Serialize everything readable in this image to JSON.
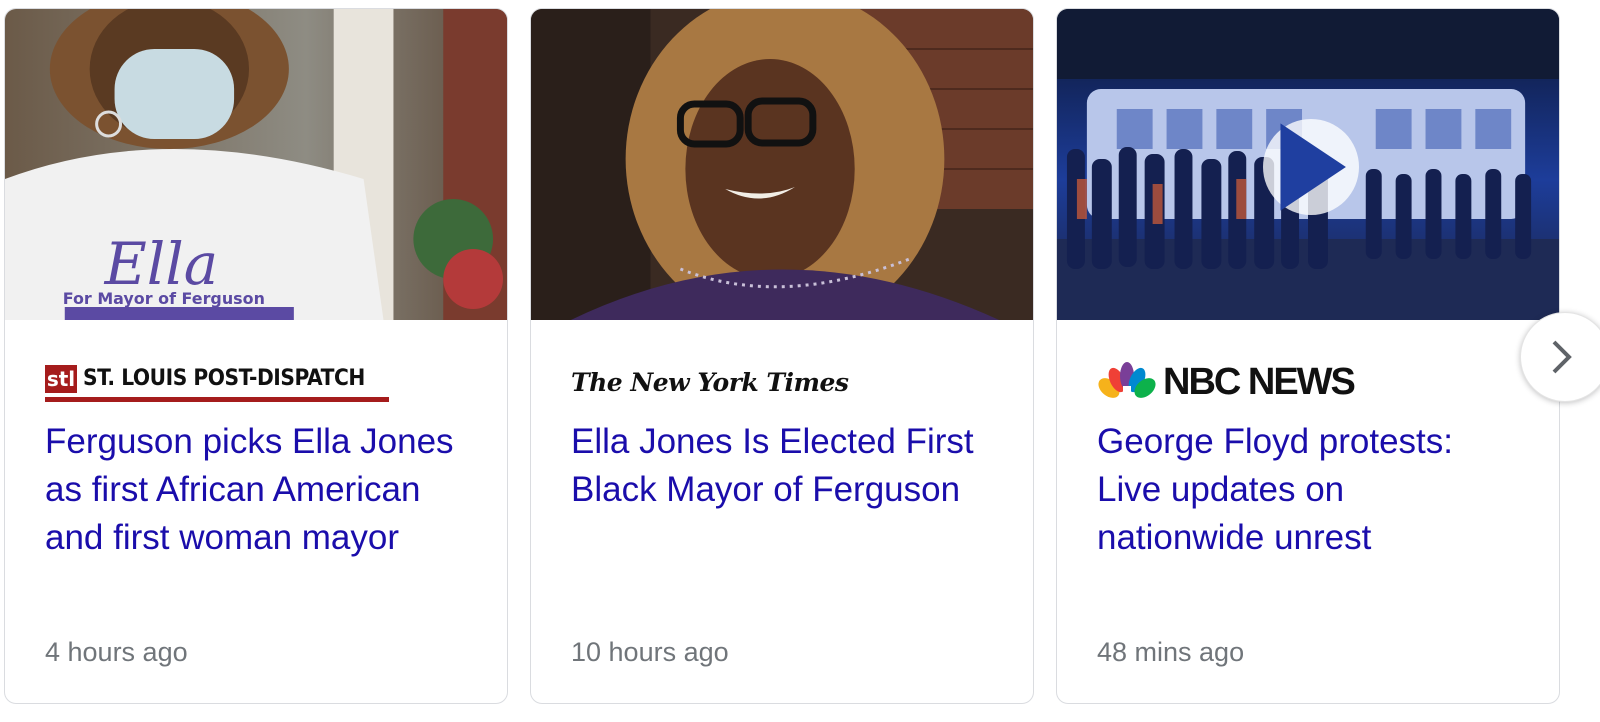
{
  "cards": [
    {
      "source": {
        "badge": "stl",
        "name": "ST. LOUIS POST-DISPATCH",
        "brand_color": "#a51c1c"
      },
      "headline": "Ferguson picks Ella Jones as first African American and first woman mayor",
      "time": "4 hours ago",
      "thumb_shirt_text": {
        "line1": "Ella",
        "line2": "For Mayor of Ferguson"
      }
    },
    {
      "source": {
        "name": "The New York Times"
      },
      "headline": "Ella Jones Is Elected First Black Mayor of Ferguson",
      "time": "10 hours ago"
    },
    {
      "source": {
        "name": "NBC NEWS"
      },
      "headline": "George Floyd protests: Live updates on nationwide unrest",
      "time": "48 mins ago",
      "has_video": true
    }
  ],
  "colors": {
    "headline": "#1a0dab",
    "timestamp": "#70757a",
    "card_border": "#dadce0"
  },
  "icons": {
    "play": "play-icon",
    "next": "chevron-right-icon",
    "nbc_logo": "nbc-peacock-icon"
  }
}
